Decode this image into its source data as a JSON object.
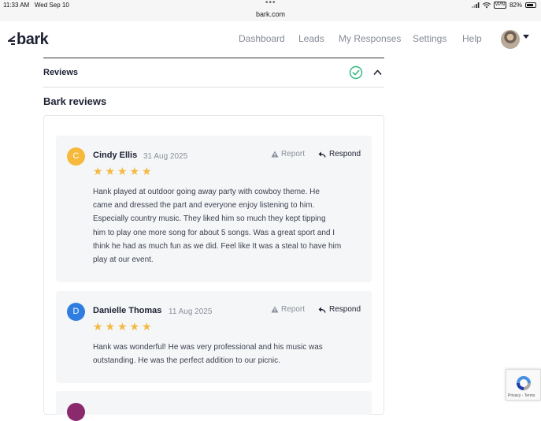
{
  "status_bar": {
    "time": "11:33 AM",
    "date": "Wed Sep 10",
    "url": "bark.com",
    "vpn": "VPN",
    "battery": "82%",
    "battery_level": 0.82
  },
  "nav": {
    "logo": "bark",
    "links": [
      "Dashboard",
      "Leads",
      "My Responses",
      "Settings",
      "Help"
    ]
  },
  "accordion": {
    "title": "Reviews",
    "status_icon": "check-circle-icon",
    "toggle_icon": "chevron-up-icon"
  },
  "section_title": "Bark reviews",
  "reviews": [
    {
      "initial": "C",
      "avatar_color": "#f6b93b",
      "name": "Cindy Ellis",
      "date": "31 Aug 2025",
      "rating": 5,
      "report_label": "Report",
      "respond_label": "Respond",
      "lines": [
        "Hank played at outdoor going away party with cowboy theme. He",
        "came and dressed the part and everyone enjoy listening to him.",
        "Especially country music. They liked him so much they kept tipping",
        "him to play one more song for about 5 songs. Was a great sport and I",
        "think he had as much fun as we did. Feel like It was a steal to have him",
        "play at our event."
      ]
    },
    {
      "initial": "D",
      "avatar_color": "#2f7de1",
      "name": "Danielle Thomas",
      "date": "11 Aug 2025",
      "rating": 5,
      "report_label": "Report",
      "respond_label": "Respond",
      "lines": [
        "Hank was wonderful! He was very professional and his music was",
        "outstanding. He was the perfect addition to our picnic."
      ]
    }
  ],
  "recaptcha_label": "Privacy - Terms",
  "colors": {
    "star": "#f4b942",
    "check": "#2fb67c",
    "accent": "#1d2133"
  }
}
